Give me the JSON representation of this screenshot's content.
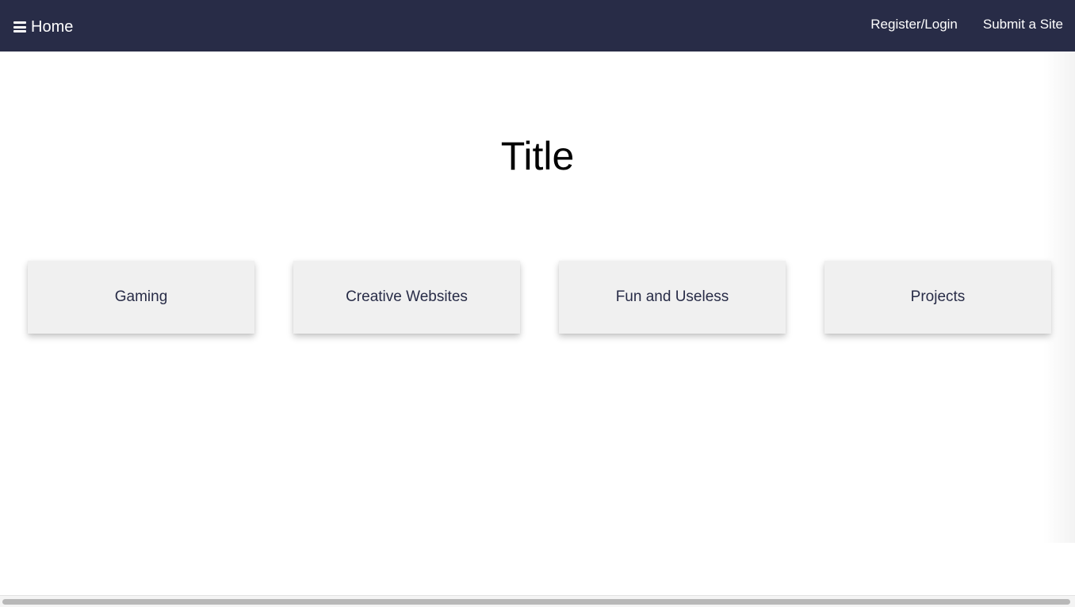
{
  "navbar": {
    "home_label": "Home",
    "menu_icon": "hamburger-icon",
    "links": [
      {
        "label": "Register/Login"
      },
      {
        "label": "Submit a Site"
      }
    ]
  },
  "main": {
    "title": "Title",
    "categories": [
      {
        "label": "Gaming"
      },
      {
        "label": "Creative Websites"
      },
      {
        "label": "Fun and Useless"
      },
      {
        "label": "Projects"
      }
    ]
  },
  "colors": {
    "navbar_bg": "#282c47",
    "card_bg": "#f0f0f0",
    "card_text": "#282c47"
  }
}
